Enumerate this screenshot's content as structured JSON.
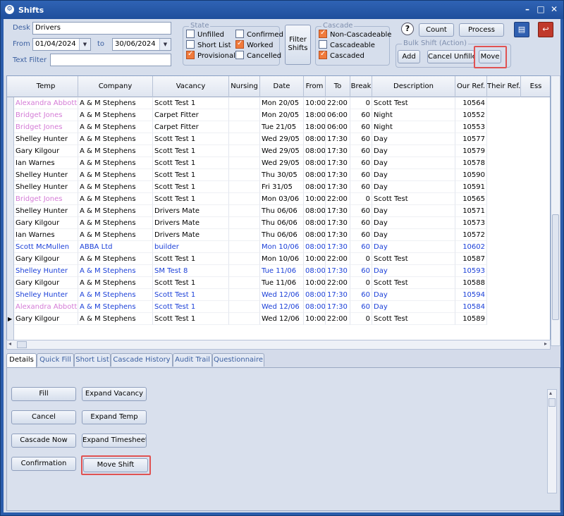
{
  "window": {
    "title": "Shifts"
  },
  "filters": {
    "desk_label": "Desk",
    "desk_value": "Drivers",
    "from_label": "From",
    "from_value": "01/04/2024",
    "to_label": "to",
    "to_value": "30/06/2024",
    "text_filter_label": "Text Filter",
    "text_filter_value": ""
  },
  "state": {
    "title": "State",
    "items": [
      {
        "label": "Unfilled",
        "checked": false
      },
      {
        "label": "Confirmed",
        "checked": false
      },
      {
        "label": "Short List",
        "checked": false
      },
      {
        "label": "Worked",
        "checked": true
      },
      {
        "label": "Provisional",
        "checked": true
      },
      {
        "label": "Cancelled",
        "checked": false
      }
    ]
  },
  "filter_button": {
    "line1": "Filter",
    "line2": "Shifts"
  },
  "cascade": {
    "title": "Cascade",
    "items": [
      {
        "label": "Non-Cascadeable",
        "checked": true
      },
      {
        "label": "Cascadeable",
        "checked": false
      },
      {
        "label": "Cascaded",
        "checked": true
      }
    ]
  },
  "toolbar": {
    "help_glyph": "?",
    "count": "Count",
    "process": "Process"
  },
  "bulk": {
    "title": "Bulk Shift (Action)",
    "add": "Add",
    "cancel_unfilled": "Cancel Unfilled",
    "move": "Move"
  },
  "grid": {
    "columns": [
      "Temp",
      "Company",
      "Vacancy",
      "Nursing",
      "Date",
      "From",
      "To",
      "Break",
      "Description",
      "Our Ref.",
      "Their Ref.",
      "Ess"
    ],
    "rows": [
      {
        "temp": "Alexandra Abbott",
        "company": "A & M Stephens",
        "vacancy": "Scott Test 1",
        "nursing": "",
        "date": "Mon 20/05",
        "from": "10:00",
        "to": "22:00",
        "brk": "0",
        "desc": "Scott Test",
        "ref": "10564",
        "style": "pink"
      },
      {
        "temp": "Bridget Jones",
        "company": "A & M Stephens",
        "vacancy": "Carpet Fitter",
        "nursing": "",
        "date": "Mon 20/05",
        "from": "18:00",
        "to": "06:00",
        "brk": "60",
        "desc": "Night",
        "ref": "10552",
        "style": "pink"
      },
      {
        "temp": "Bridget Jones",
        "company": "A & M Stephens",
        "vacancy": "Carpet Fitter",
        "nursing": "",
        "date": "Tue 21/05",
        "from": "18:00",
        "to": "06:00",
        "brk": "60",
        "desc": "Night",
        "ref": "10553",
        "style": "pink"
      },
      {
        "temp": "Shelley Hunter",
        "company": "A & M Stephens",
        "vacancy": "Scott Test 1",
        "nursing": "",
        "date": "Wed 29/05",
        "from": "08:00",
        "to": "17:30",
        "brk": "60",
        "desc": "Day",
        "ref": "10577",
        "style": "normal"
      },
      {
        "temp": "Gary Kilgour",
        "company": "A & M Stephens",
        "vacancy": "Scott Test 1",
        "nursing": "",
        "date": "Wed 29/05",
        "from": "08:00",
        "to": "17:30",
        "brk": "60",
        "desc": "Day",
        "ref": "10579",
        "style": "normal"
      },
      {
        "temp": "Ian Warnes",
        "company": "A & M Stephens",
        "vacancy": "Scott Test 1",
        "nursing": "",
        "date": "Wed 29/05",
        "from": "08:00",
        "to": "17:30",
        "brk": "60",
        "desc": "Day",
        "ref": "10578",
        "style": "normal"
      },
      {
        "temp": "Shelley Hunter",
        "company": "A & M Stephens",
        "vacancy": "Scott Test 1",
        "nursing": "",
        "date": "Thu 30/05",
        "from": "08:00",
        "to": "17:30",
        "brk": "60",
        "desc": "Day",
        "ref": "10590",
        "style": "normal"
      },
      {
        "temp": "Shelley Hunter",
        "company": "A & M Stephens",
        "vacancy": "Scott Test 1",
        "nursing": "",
        "date": "Fri 31/05",
        "from": "08:00",
        "to": "17:30",
        "brk": "60",
        "desc": "Day",
        "ref": "10591",
        "style": "normal"
      },
      {
        "temp": "Bridget Jones",
        "company": "A & M Stephens",
        "vacancy": "Scott Test 1",
        "nursing": "",
        "date": "Mon 03/06",
        "from": "10:00",
        "to": "22:00",
        "brk": "0",
        "desc": "Scott Test",
        "ref": "10565",
        "style": "pink"
      },
      {
        "temp": "Shelley Hunter",
        "company": "A & M Stephens",
        "vacancy": "Drivers Mate",
        "nursing": "",
        "date": "Thu 06/06",
        "from": "08:00",
        "to": "17:30",
        "brk": "60",
        "desc": "Day",
        "ref": "10571",
        "style": "normal"
      },
      {
        "temp": "Gary Kilgour",
        "company": "A & M Stephens",
        "vacancy": "Drivers Mate",
        "nursing": "",
        "date": "Thu 06/06",
        "from": "08:00",
        "to": "17:30",
        "brk": "60",
        "desc": "Day",
        "ref": "10573",
        "style": "normal"
      },
      {
        "temp": "Ian Warnes",
        "company": "A & M Stephens",
        "vacancy": "Drivers Mate",
        "nursing": "",
        "date": "Thu 06/06",
        "from": "08:00",
        "to": "17:30",
        "brk": "60",
        "desc": "Day",
        "ref": "10572",
        "style": "normal"
      },
      {
        "temp": "Scott McMullen",
        "company": "ABBA Ltd",
        "vacancy": "builder",
        "nursing": "",
        "date": "Mon 10/06",
        "from": "08:00",
        "to": "17:30",
        "brk": "60",
        "desc": "Day",
        "ref": "10602",
        "style": "blue"
      },
      {
        "temp": "Gary Kilgour",
        "company": "A & M Stephens",
        "vacancy": "Scott Test 1",
        "nursing": "",
        "date": "Mon 10/06",
        "from": "10:00",
        "to": "22:00",
        "brk": "0",
        "desc": "Scott Test",
        "ref": "10587",
        "style": "normal"
      },
      {
        "temp": "Shelley Hunter",
        "company": "A & M Stephens",
        "vacancy": "SM Test 8",
        "nursing": "",
        "date": "Tue 11/06",
        "from": "08:00",
        "to": "17:30",
        "brk": "60",
        "desc": "Day",
        "ref": "10593",
        "style": "blue"
      },
      {
        "temp": "Gary Kilgour",
        "company": "A & M Stephens",
        "vacancy": "Scott Test 1",
        "nursing": "",
        "date": "Tue 11/06",
        "from": "10:00",
        "to": "22:00",
        "brk": "0",
        "desc": "Scott Test",
        "ref": "10588",
        "style": "normal"
      },
      {
        "temp": "Shelley Hunter",
        "company": "A & M Stephens",
        "vacancy": "Scott Test 1",
        "nursing": "",
        "date": "Wed 12/06",
        "from": "08:00",
        "to": "17:30",
        "brk": "60",
        "desc": "Day",
        "ref": "10594",
        "style": "blue"
      },
      {
        "temp": "Alexandra Abbott",
        "company": "A & M Stephens",
        "vacancy": "Scott Test 1",
        "nursing": "",
        "date": "Wed 12/06",
        "from": "08:00",
        "to": "17:30",
        "brk": "60",
        "desc": "Day",
        "ref": "10584",
        "style": "pinkblue"
      },
      {
        "temp": "Gary Kilgour",
        "company": "A & M Stephens",
        "vacancy": "Scott Test 1",
        "nursing": "",
        "date": "Wed 12/06",
        "from": "10:00",
        "to": "22:00",
        "brk": "0",
        "desc": "Scott Test",
        "ref": "10589",
        "style": "normal"
      }
    ]
  },
  "tabs": [
    "Details",
    "Quick Fill",
    "Short List",
    "Cascade History",
    "Audit Trail",
    "Questionnaire"
  ],
  "actions": {
    "fill": "Fill",
    "expand_vacancy": "Expand Vacancy",
    "cancel": "Cancel",
    "expand_temp": "Expand Temp",
    "cascade_now": "Cascade Now",
    "expand_timesheet": "Expand Timesheet",
    "confirmation": "Confirmation",
    "move_shift": "Move Shift"
  },
  "colors": {
    "pink": "#d47bd6",
    "blue": "#1a3fd8",
    "highlight": "#e05252",
    "checked": "#f07a3c"
  }
}
